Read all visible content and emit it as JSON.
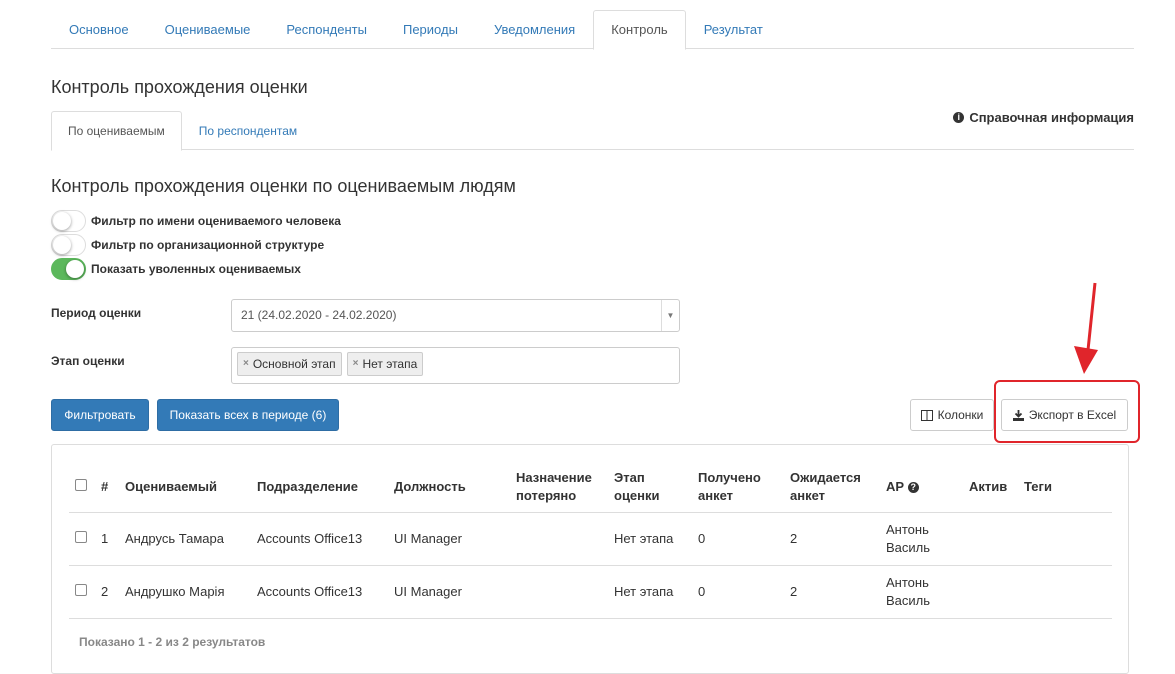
{
  "top_tabs": [
    "Основное",
    "Оцениваемые",
    "Респонденты",
    "Периоды",
    "Уведомления",
    "Контроль",
    "Результат"
  ],
  "top_tab_active": "Контроль",
  "title": "Контроль прохождения оценки",
  "info_link": "Справочная информация",
  "sub_tabs": [
    "По оцениваемым",
    "По респондентам"
  ],
  "subtitle": "Контроль прохождения оценки по оцениваемым людям",
  "toggles": [
    {
      "label": "Фильтр по имени оцениваемого человека",
      "on": false
    },
    {
      "label": "Фильтр по организационной структуре",
      "on": false
    },
    {
      "label": "Показать уволенных оцениваемых",
      "on": true
    }
  ],
  "period": {
    "label": "Период оценки",
    "value": "21 (24.02.2020 - 24.02.2020)"
  },
  "stage": {
    "label": "Этап оценки",
    "tags": [
      "Основной этап",
      "Нет этапа"
    ]
  },
  "buttons": {
    "filter": "Фильтровать",
    "show_all": "Показать всех в периоде (6)",
    "columns": "Колонки",
    "export": "Экспорт в Excel"
  },
  "table": {
    "headers": {
      "num": "#",
      "evaluated": "Оцениваемый",
      "department": "Подразделение",
      "position": "Должность",
      "lost_line1": "Назначение",
      "lost_line2": "потеряно",
      "stage_line1": "Этап",
      "stage_line2": "оценки",
      "received_line1": "Получено",
      "received_line2": "анкет",
      "expected_line1": "Ожидается",
      "expected_line2": "анкет",
      "ap": "АР",
      "active": "Актив",
      "tags": "Теги"
    },
    "rows": [
      {
        "num": "1",
        "name": "Андрусь Тамара",
        "department": "Accounts Office13",
        "position": "UI Manager",
        "lost": "",
        "stage": "Нет этапа",
        "received": "0",
        "expected": "2",
        "ap_line1": "Антонь",
        "ap_line2": "Василь",
        "active": "",
        "tags": ""
      },
      {
        "num": "2",
        "name": "Андрушко Марія",
        "department": "Accounts Office13",
        "position": "UI Manager",
        "lost": "",
        "stage": "Нет этапа",
        "received": "0",
        "expected": "2",
        "ap_line1": "Антонь",
        "ap_line2": "Василь",
        "active": "",
        "tags": ""
      }
    ],
    "footer": "Показано 1 - 2 из 2 результатов"
  },
  "colors": {
    "primary": "#337ab7",
    "toggle_on": "#5cb85c",
    "annotation": "#e0252b"
  }
}
